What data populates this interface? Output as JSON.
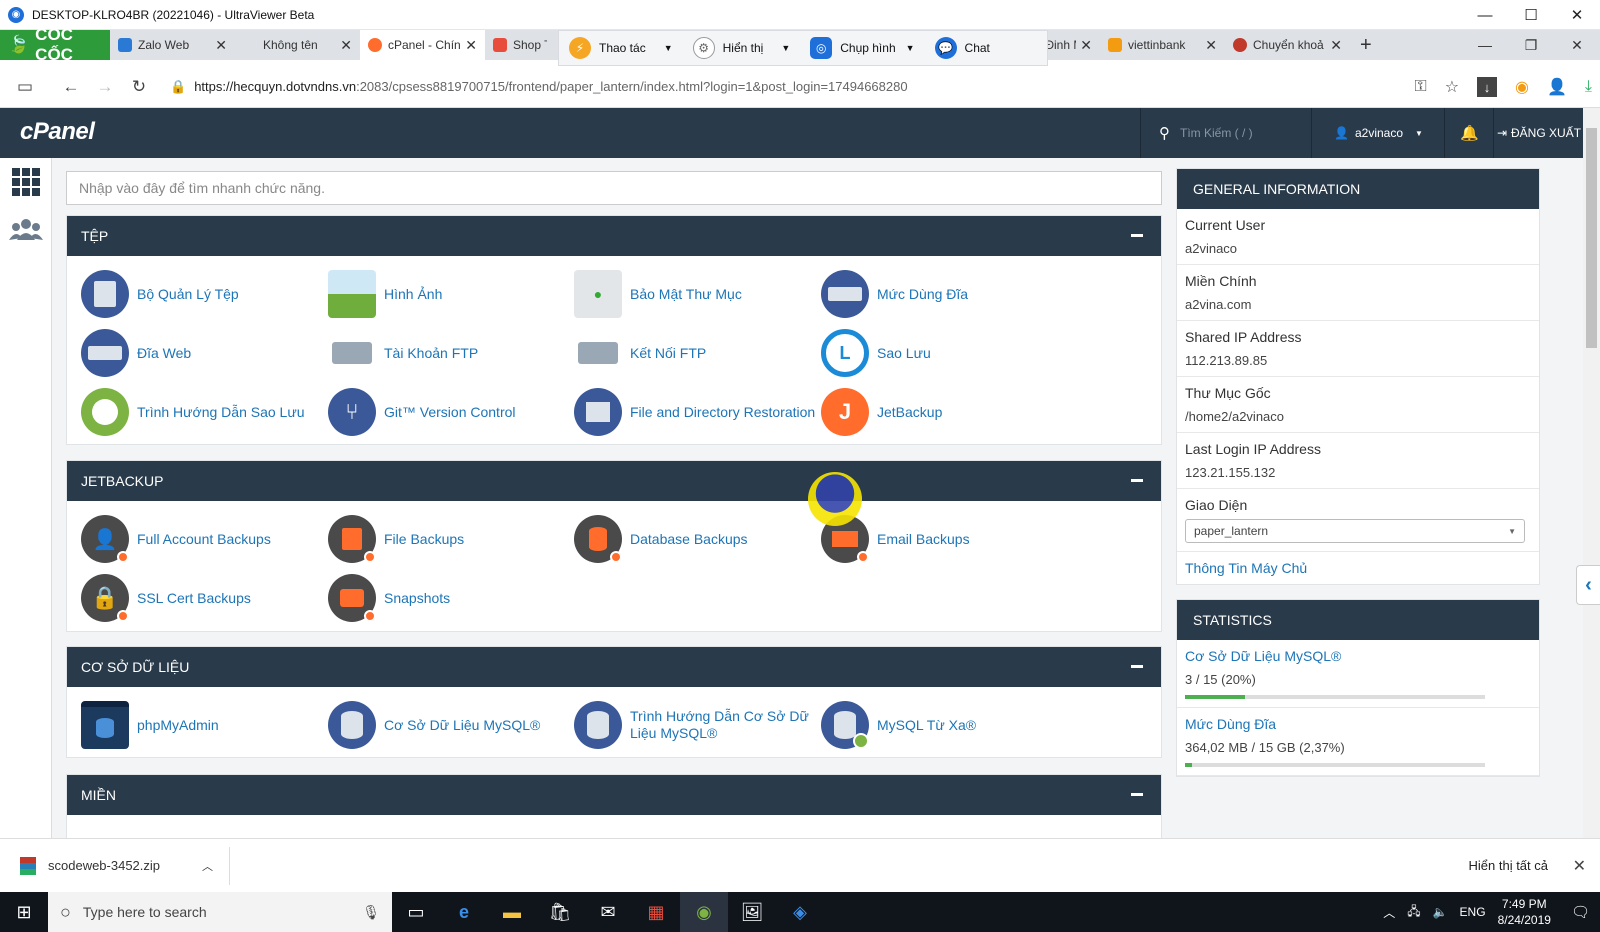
{
  "window": {
    "title": "DESKTOP-KLRO4BR (20221046) - UltraViewer Beta"
  },
  "browser": {
    "brand": "CỐC CỐC",
    "tabs": [
      {
        "label": "Zalo Web",
        "color": "#2a7ad5"
      },
      {
        "label": "Không tên",
        "color": "#dee1e6"
      },
      {
        "label": "cPanel - Chín",
        "color": "#ff6c2c"
      },
      {
        "label": "Shop T",
        "color": "#e74c3c"
      },
      {
        "label": "h - Đinh M",
        "color": "#999999"
      },
      {
        "label": "viettinbank",
        "color": "#f39c12"
      },
      {
        "label": "Chuyển khoả",
        "color": "#c0392b"
      }
    ],
    "url_host": "https://hecquyn.dotvndns.vn",
    "url_path": ":2083/cpsess8819700715/frontend/paper_lantern/index.html?login=1&post_login=17494668280"
  },
  "ultraviewer": {
    "thao_tac": "Thao tác",
    "hien_thi": "Hiển thị",
    "chup_hinh": "Chụp hình",
    "chat": "Chat"
  },
  "cpanel": {
    "logo": "cPanel",
    "search_placeholder": "Tìm Kiếm ( / )",
    "user": "a2vinaco",
    "logout": "ĐĂNG XUẤT",
    "quick_search_placeholder": "Nhập vào đây để tìm nhanh chức năng.",
    "sections": {
      "files": {
        "title": "TỆP",
        "items": [
          "Bộ Quản Lý Tệp",
          "Hình Ảnh",
          "Bảo Mật Thư Mục",
          "Mức Dùng Đĩa",
          "Đĩa Web",
          "Tài Khoản FTP",
          "Kết Nối FTP",
          "Sao Lưu",
          "Trình Hướng Dẫn Sao Lưu",
          "Git™ Version Control",
          "File and Directory Restoration",
          "JetBackup"
        ]
      },
      "jetbackup": {
        "title": "JETBACKUP",
        "items": [
          "Full Account Backups",
          "File Backups",
          "Database Backups",
          "Email Backups",
          "SSL Cert Backups",
          "Snapshots"
        ]
      },
      "databases": {
        "title": "CƠ SỞ DỮ LIỆU",
        "items": [
          "phpMyAdmin",
          "Cơ Sở Dữ Liệu MySQL®",
          "Trình Hướng Dẫn Cơ Sở Dữ Liệu MySQL®",
          "MySQL Từ Xa®"
        ]
      },
      "domains": {
        "title": "MIỀN"
      }
    },
    "general_info": {
      "title": "GENERAL INFORMATION",
      "current_user_label": "Current User",
      "current_user": "a2vinaco",
      "main_domain_label": "Miền Chính",
      "main_domain": "a2vina.com",
      "shared_ip_label": "Shared IP Address",
      "shared_ip": "112.213.89.85",
      "home_dir_label": "Thư Mục Gốc",
      "home_dir": "/home2/a2vinaco",
      "last_login_label": "Last Login IP Address",
      "last_login": "123.21.155.132",
      "theme_label": "Giao Diện",
      "theme": "paper_lantern",
      "server_info": "Thông Tin Máy Chủ"
    },
    "statistics": {
      "title": "STATISTICS",
      "mysql_label": "Cơ Sở Dữ Liệu MySQL®",
      "mysql_value": "3 / 15   (20%)",
      "mysql_percent": 20,
      "disk_label": "Mức Dùng Đĩa",
      "disk_value": "364,02 MB / 15 GB   (2,37%)",
      "disk_percent": 2.37
    }
  },
  "download": {
    "file": "scodeweb-3452.zip",
    "show_all": "Hiển thị tất cả"
  },
  "taskbar": {
    "search_placeholder": "Type here to search",
    "lang": "ENG",
    "time": "7:49 PM",
    "date": "8/24/2019"
  }
}
